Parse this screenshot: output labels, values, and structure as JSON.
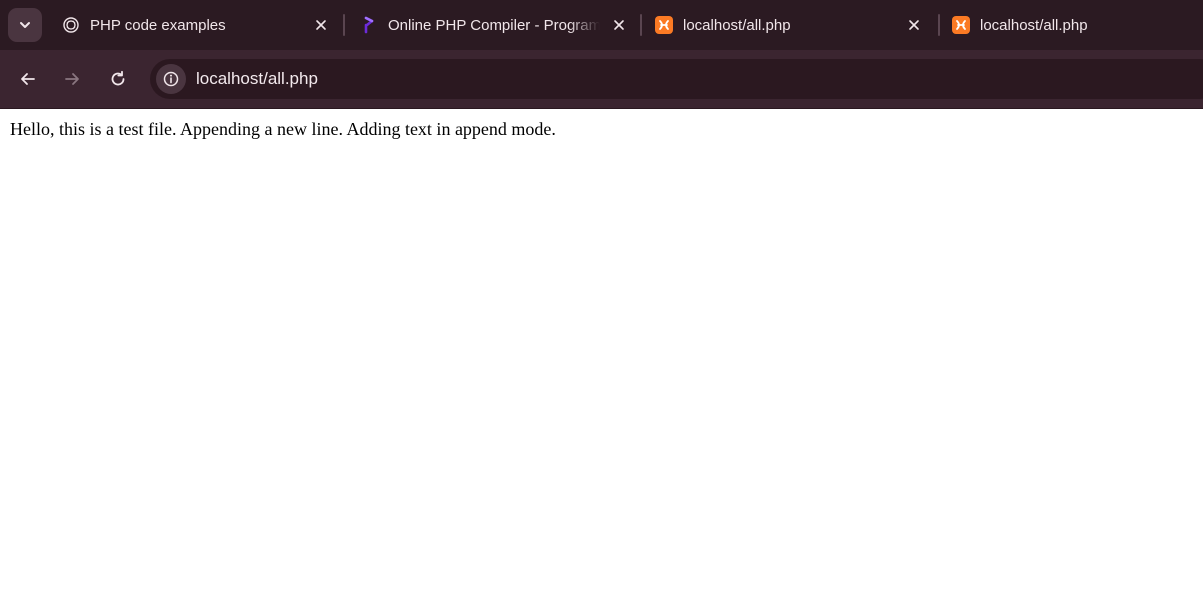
{
  "tabs": [
    {
      "title": "PHP code examples",
      "icon": "chatgpt-icon",
      "closable": true
    },
    {
      "title": "Online PHP Compiler - Programiz",
      "icon": "programiz-icon",
      "closable": true
    },
    {
      "title": "localhost/all.php",
      "icon": "xampp-icon",
      "closable": true,
      "active": true
    },
    {
      "title": "localhost/all.php",
      "icon": "xampp-icon",
      "closable": false
    }
  ],
  "toolbar": {
    "url": "localhost/all.php"
  },
  "page": {
    "text": "Hello, this is a test file. Appending a new line. Adding text in append mode."
  },
  "colors": {
    "tabstrip_bg": "#2b1a22",
    "toolbar_bg": "#3b2530",
    "omnibox_bg": "#2b1820",
    "xampp_orange": "#fb7a24",
    "programiz_purple": "#6c2bd9"
  }
}
